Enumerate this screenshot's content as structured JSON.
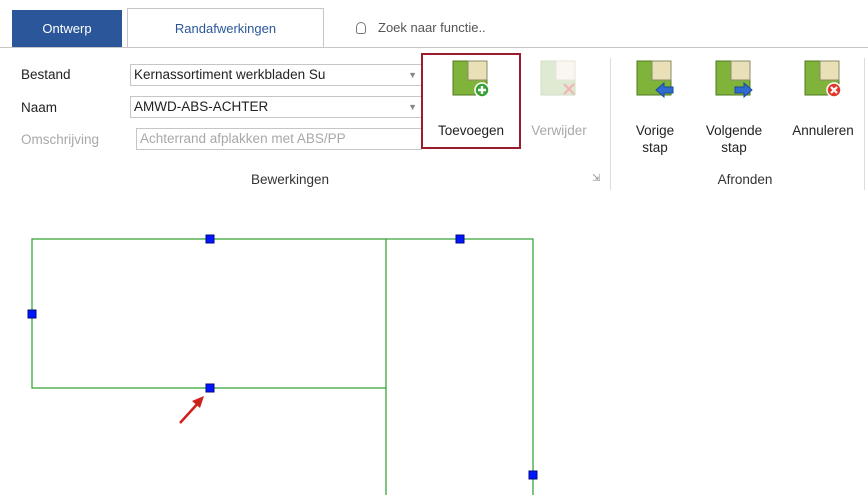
{
  "tabs": {
    "ontwerp": "Ontwerp",
    "randafwerkingen": "Randafwerkingen",
    "tell_me_placeholder": "Zoek naar functie.."
  },
  "fields": {
    "bestand_label": "Bestand",
    "bestand_value": "Kernassortiment werkbladen Su",
    "naam_label": "Naam",
    "naam_value": "AMWD-ABS-ACHTER",
    "omschrijving_label": "Omschrijving",
    "omschrijving_value": "Achterrand afplakken met ABS/PP"
  },
  "buttons": {
    "toevoegen": "Toevoegen",
    "verwijder": "Verwijder",
    "vorige_1": "Vorige",
    "vorige_2": "stap",
    "volgende_1": "Volgende",
    "volgende_2": "stap",
    "annuleren": "Annuleren"
  },
  "groups": {
    "bewerkingen": "Bewerkingen",
    "afronden": "Afronden"
  },
  "colors": {
    "accent": "#2b579a",
    "highlight_border": "#9b1c2c",
    "shape_green": "#3aa33a",
    "handle_blue": "#0016ff",
    "arrow_red": "#d0201a"
  },
  "icons": {
    "toevoegen": "add-piece-icon",
    "verwijder": "remove-piece-icon",
    "vorige": "previous-step-icon",
    "volgende": "next-step-icon",
    "annuleren": "cancel-icon"
  }
}
